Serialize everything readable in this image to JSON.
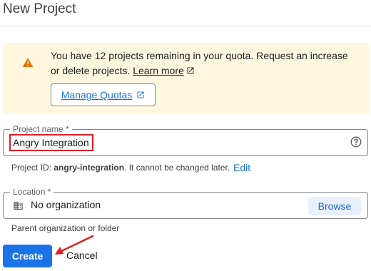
{
  "dialog": {
    "title": "New Project"
  },
  "quota": {
    "message": "You have 12 projects remaining in your quota. Request an increase or delete projects.",
    "learn_more": "Learn more",
    "manage_button": "Manage Quotas"
  },
  "project_name": {
    "label": "Project name *",
    "value": "Angry Integration"
  },
  "project_id": {
    "prefix": "Project ID:",
    "id": "angry-integration",
    "suffix": ". It cannot be changed later.",
    "edit_label": "Edit"
  },
  "location": {
    "label": "Location *",
    "value": "No organization",
    "browse_label": "Browse",
    "helper": "Parent organization or folder"
  },
  "actions": {
    "create_label": "Create",
    "cancel_label": "Cancel"
  },
  "colors": {
    "primary": "#1a73e8",
    "warning_bg": "#fef7e0",
    "warning_icon": "#e37400",
    "annotation": "#e01e24"
  }
}
